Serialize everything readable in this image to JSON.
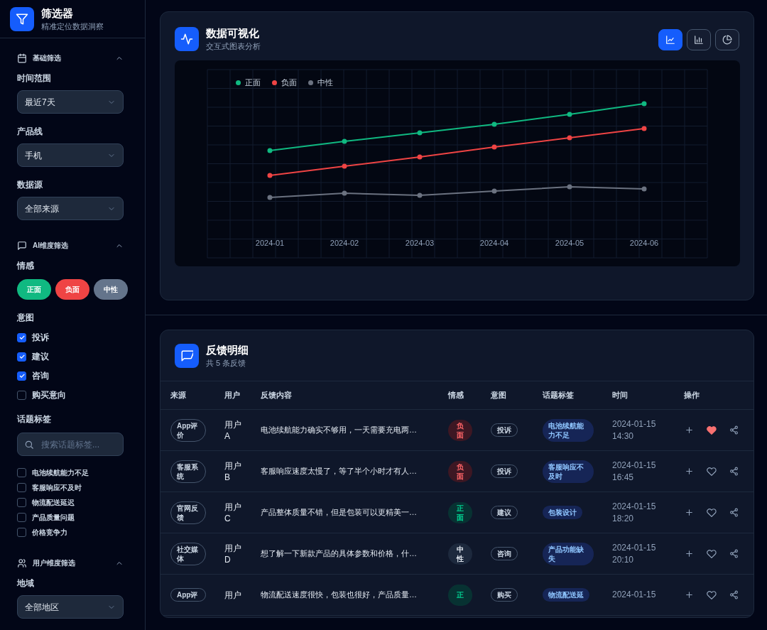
{
  "sidebar": {
    "title": "筛选器",
    "subtitle": "精准定位数据洞察",
    "sections": [
      {
        "kind": "basic",
        "title": "基础筛选",
        "expanded": true,
        "fields": [
          {
            "label": "时间范围",
            "value": "最近7天"
          },
          {
            "label": "产品线",
            "value": "手机"
          },
          {
            "label": "数据源",
            "value": "全部来源"
          }
        ]
      },
      {
        "kind": "ai",
        "title": "AI维度筛选",
        "expanded": true,
        "sentiment": {
          "label": "情感",
          "chips": [
            {
              "label": "正面",
              "color": "#10b981"
            },
            {
              "label": "负面",
              "color": "#ef4444"
            },
            {
              "label": "中性",
              "color": "#64748b"
            }
          ]
        },
        "intent": {
          "label": "意图",
          "options": [
            {
              "label": "投诉",
              "checked": true
            },
            {
              "label": "建议",
              "checked": true
            },
            {
              "label": "咨询",
              "checked": true
            },
            {
              "label": "购买意向",
              "checked": false
            }
          ]
        },
        "topics": {
          "label": "话题标签",
          "search_placeholder": "搜索话题标签...",
          "options": [
            {
              "label": "电池续航能力不足",
              "checked": false
            },
            {
              "label": "客服响应不及时",
              "checked": false
            },
            {
              "label": "物流配送延迟",
              "checked": false
            },
            {
              "label": "产品质量问题",
              "checked": false
            },
            {
              "label": "价格竞争力",
              "checked": false
            }
          ]
        }
      },
      {
        "kind": "user",
        "title": "用户维度筛选",
        "expanded": true,
        "fields": [
          {
            "label": "地域",
            "value": "全部地区"
          }
        ]
      }
    ]
  },
  "chart_panel": {
    "title": "数据可视化",
    "subtitle": "交互式图表分析",
    "view_buttons": [
      {
        "kind": "line",
        "selected": true
      },
      {
        "kind": "bar",
        "selected": false
      },
      {
        "kind": "pie",
        "selected": false
      }
    ],
    "legend": [
      {
        "label": "正面",
        "color": "#10b981"
      },
      {
        "label": "负面",
        "color": "#ef4444"
      },
      {
        "label": "中性",
        "color": "#6b7280"
      }
    ],
    "x_labels": [
      "2024-01",
      "2024-02",
      "2024-03",
      "2024-04",
      "2024-05",
      "2024-06"
    ]
  },
  "feedback": {
    "title": "反馈明细",
    "subtitle": "共 5 条反馈",
    "columns": [
      "来源",
      "用户",
      "反馈内容",
      "情感",
      "意图",
      "话题标签",
      "时间",
      "操作"
    ],
    "rows": [
      {
        "source": "App评价",
        "user": "用户A",
        "content": "电池续航能力确实不够用，一天需要充电两…",
        "sentiment": {
          "label": "负面",
          "kind": "negative"
        },
        "intent": "投诉",
        "topic": "电池续航能力不足",
        "time": "2024-01-15 14:30",
        "liked": true
      },
      {
        "source": "客服系统",
        "user": "用户B",
        "content": "客服响应速度太慢了，等了半个小时才有人…",
        "sentiment": {
          "label": "负面",
          "kind": "negative"
        },
        "intent": "投诉",
        "topic": "客服响应不及时",
        "time": "2024-01-15 16:45",
        "liked": false
      },
      {
        "source": "官网反馈",
        "user": "用户C",
        "content": "产品整体质量不错，但是包装可以更精美一…",
        "sentiment": {
          "label": "正面",
          "kind": "positive"
        },
        "intent": "建议",
        "topic": "包装设计",
        "time": "2024-01-15 18:20",
        "liked": false
      },
      {
        "source": "社交媒体",
        "user": "用户D",
        "content": "想了解一下新款产品的具体参数和价格，什…",
        "sentiment": {
          "label": "中性",
          "kind": "neutral"
        },
        "intent": "咨询",
        "topic": "产品功能缺失",
        "time": "2024-01-15 20:10",
        "liked": false
      },
      {
        "source": "App评",
        "user": "用户",
        "content": "物流配送速度很快，包装也很好，产品质量…",
        "sentiment": {
          "label": "正",
          "kind": "positive"
        },
        "intent": "购买",
        "topic": "物流配送延",
        "time": "2024-01-15",
        "liked": false
      }
    ]
  }
}
